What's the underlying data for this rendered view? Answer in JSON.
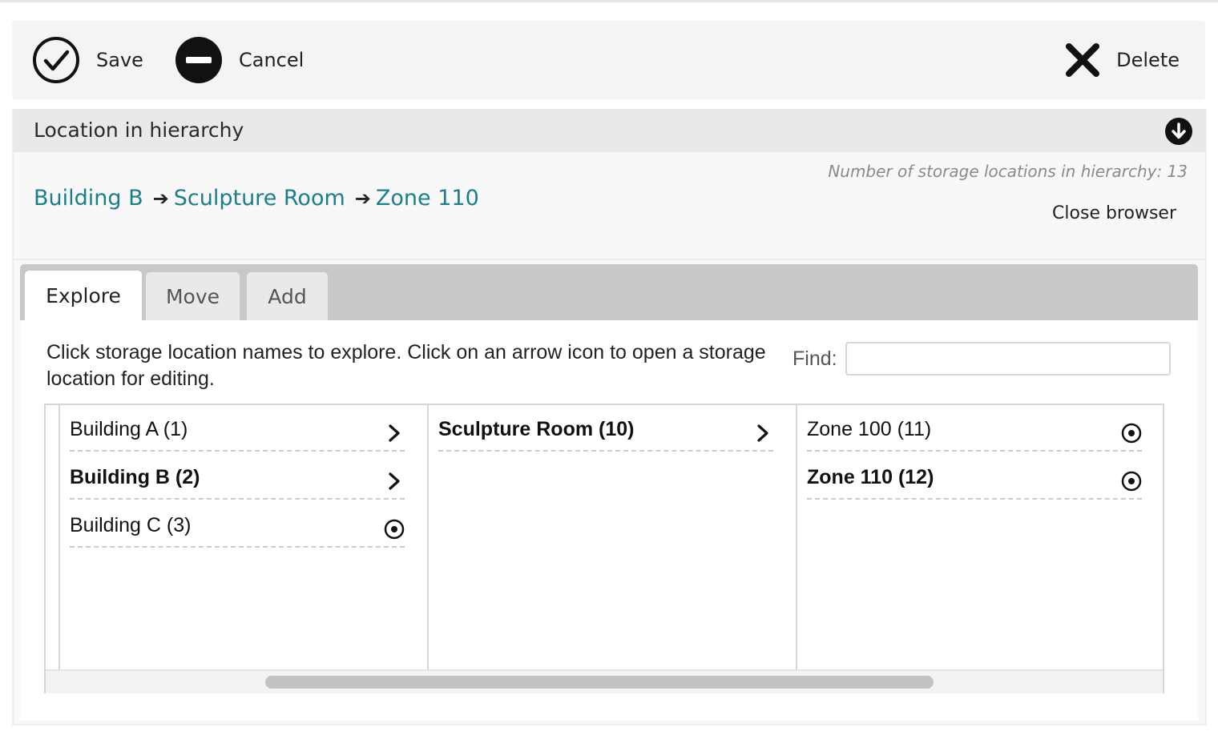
{
  "toolbar": {
    "save_label": "Save",
    "cancel_label": "Cancel",
    "delete_label": "Delete"
  },
  "panel": {
    "title": "Location in hierarchy",
    "count_text": "Number of storage locations in hierarchy: 13",
    "breadcrumb": [
      "Building B",
      "Sculpture Room",
      "Zone 110"
    ],
    "breadcrumb_separator": "➔",
    "close_browser_label": "Close browser"
  },
  "tabs": [
    {
      "label": "Explore",
      "active": true
    },
    {
      "label": "Move",
      "active": false
    },
    {
      "label": "Add",
      "active": false
    }
  ],
  "explore": {
    "instructions": "Click storage location names to explore. Click on an arrow icon to open a storage location for editing.",
    "find_label": "Find:",
    "find_value": "",
    "columns": [
      [
        {
          "label": "Building A (1)",
          "bold": false,
          "icon": "chevron-right-icon"
        },
        {
          "label": "Building B (2)",
          "bold": true,
          "icon": "chevron-right-icon"
        },
        {
          "label": "Building C (3)",
          "bold": false,
          "icon": "radio-target-icon"
        }
      ],
      [
        {
          "label": "Sculpture Room (10)",
          "bold": true,
          "icon": "chevron-right-icon"
        }
      ],
      [
        {
          "label": "Zone 100 (11)",
          "bold": false,
          "icon": "radio-target-icon"
        },
        {
          "label": "Zone 110 (12)",
          "bold": true,
          "icon": "radio-target-icon"
        }
      ]
    ]
  },
  "colors": {
    "link": "#1a7f8a",
    "tabbar": "#c8c8c8",
    "panel_header": "#e9e9e9",
    "toolbar_bg": "#f4f4f4"
  }
}
